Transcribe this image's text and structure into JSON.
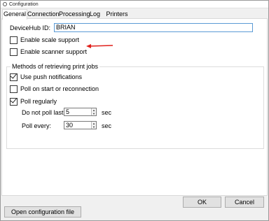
{
  "window": {
    "title": "Configuration"
  },
  "tabs": [
    {
      "label": "General",
      "active": true
    },
    {
      "label": "Connection",
      "active": false
    },
    {
      "label": "Processing",
      "active": false
    },
    {
      "label": "Log",
      "active": false
    },
    {
      "label": "Printers",
      "active": false
    }
  ],
  "general": {
    "devicehub_label": "DeviceHub ID:",
    "devicehub_value": "BRIAN",
    "scale": {
      "label": "Enable scale support",
      "checked": false
    },
    "scanner": {
      "label": "Enable scanner support",
      "checked": false
    },
    "methods": {
      "legend": "Methods of retrieving print jobs",
      "push": {
        "label": "Use push notifications",
        "checked": true
      },
      "start": {
        "label": "Poll on start or reconnection",
        "checked": false
      },
      "regular": {
        "label": "Poll regularly",
        "checked": true
      },
      "no_poll": {
        "label": "Do not poll last:",
        "value": "5",
        "unit": "sec"
      },
      "every": {
        "label": "Poll every:",
        "value": "30",
        "unit": "sec"
      }
    }
  },
  "buttons": {
    "ok": "OK",
    "cancel": "Cancel",
    "open_config": "Open configuration file"
  },
  "colors": {
    "annotation_arrow": "#e0201b",
    "focus_border": "#5b9bd5"
  }
}
